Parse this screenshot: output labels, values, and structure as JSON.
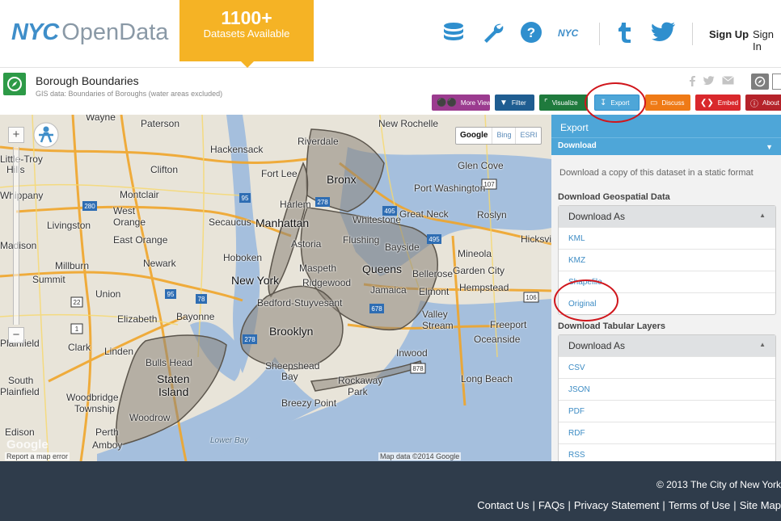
{
  "header": {
    "logo_nyc": "NYC",
    "logo_opendata": "OpenData",
    "badge_count": "1100+",
    "badge_label": "Datasets Available",
    "icons": [
      "database-icon",
      "wrench-icon",
      "help-icon",
      "nyc-icon",
      "tumblr-icon",
      "twitter-icon"
    ],
    "nyc_mini": "NYC",
    "sign_up": "Sign Up",
    "sign_in": "Sign In"
  },
  "dataset": {
    "title": "Borough Boundaries",
    "subtitle": "GIS data: Boundaries of Boroughs (water areas excluded)",
    "share_icons": [
      "facebook-icon",
      "twitter-icon",
      "email-icon"
    ],
    "toolbar": {
      "more_views": "More Views",
      "filter": "Filter",
      "visualize": "Visualize",
      "export": "Export",
      "discuss": "Discuss",
      "embed": "Embed",
      "about": "About"
    },
    "colors": {
      "more_views": "#9b3b8f",
      "filter": "#1f5d91",
      "visualize": "#1f7a3d",
      "export": "#4ea6d8",
      "discuss": "#ef7a16",
      "embed": "#d9282c",
      "about": "#b5232a"
    }
  },
  "map": {
    "layers": [
      "Google",
      "Bing",
      "ESRI"
    ],
    "labels": {
      "wayne": "Wayne",
      "paterson": "Paterson",
      "new_rochelle": "New Rochelle",
      "riverdale": "Riverdale",
      "hackensack": "Hackensack",
      "little_troy": "Little-Troy",
      "hills": "Hills",
      "clifton": "Clifton",
      "fort_lee": "Fort Lee",
      "bronx": "Bronx",
      "glen_cove": "Glen Cove",
      "whippany": "Whippany",
      "montclair": "Montclair",
      "harlem": "Harlem",
      "port_washington": "Port Washington",
      "west_orange": "West",
      "west_orange2": "Orange",
      "secaucus": "Secaucus",
      "manhattan": "Manhattan",
      "whitestone": "Whitestone",
      "great_neck": "Great Neck",
      "roslyn": "Roslyn",
      "livingston": "Livingston",
      "east_orange": "East Orange",
      "astoria": "Astoria",
      "flushing": "Flushing",
      "bayside": "Bayside",
      "hicksville": "Hicksville",
      "madison": "Madison",
      "hoboken": "Hoboken",
      "mineola": "Mineola",
      "millburn": "Millburn",
      "newark": "Newark",
      "maspeth": "Maspeth",
      "queens": "Queens",
      "garden_city": "Garden City",
      "summit": "Summit",
      "new_york": "New York",
      "ridgewood": "Ridgewood",
      "bellerose": "Bellerose",
      "hempstead": "Hempstead",
      "jamaica": "Jamaica",
      "elmont": "Elmont",
      "union": "Union",
      "bedford": "Bedford-Stuyvesant",
      "elizabeth": "Elizabeth",
      "bayonne": "Bayonne",
      "valley": "Valley",
      "stream": "Stream",
      "brooklyn": "Brooklyn",
      "freeport": "Freeport",
      "oceanside": "Oceanside",
      "plainfield": "Plainfield",
      "clark": "Clark",
      "linden": "Linden",
      "inwood": "Inwood",
      "bulls_head": "Bulls Head",
      "sheepshead": "Sheepshead",
      "bay": "Bay",
      "staten": "Staten",
      "island": "Island",
      "long_beach": "Long Beach",
      "south": "South",
      "plainfield2": "Plainfield",
      "rockaway": "Rockaway",
      "park": "Park",
      "woodbridge": "Woodbridge",
      "township": "Township",
      "breezy_point": "Breezy Point",
      "woodrow": "Woodrow",
      "edison": "Edison",
      "perth": "Perth",
      "amboy": "Amboy",
      "lower_bay": "Lower Bay"
    },
    "shields": [
      "280",
      "95",
      "278",
      "495",
      "107",
      "495",
      "78",
      "95",
      "106",
      "678",
      "278",
      "22",
      "1",
      "878"
    ],
    "google_logo": "Google",
    "report": "Report a map error",
    "map_data": "Map data ©2014 Google"
  },
  "export_panel": {
    "title": "Export",
    "section": "Download",
    "description": "Download a copy of this dataset in a static format",
    "geo_heading": "Download Geospatial Data",
    "geo_dropdown": "Download As",
    "geo_items": [
      "KML",
      "KMZ",
      "Shapefile",
      "Original"
    ],
    "tab_heading": "Download Tabular Layers",
    "tab_dropdown": "Download As",
    "tab_items": [
      "CSV",
      "JSON",
      "PDF",
      "RDF",
      "RSS"
    ]
  },
  "footer": {
    "copyright": "© 2013 The City of New York",
    "links": [
      "Contact Us",
      "FAQs",
      "Privacy Statement",
      "Terms of Use",
      "Site Map"
    ]
  }
}
